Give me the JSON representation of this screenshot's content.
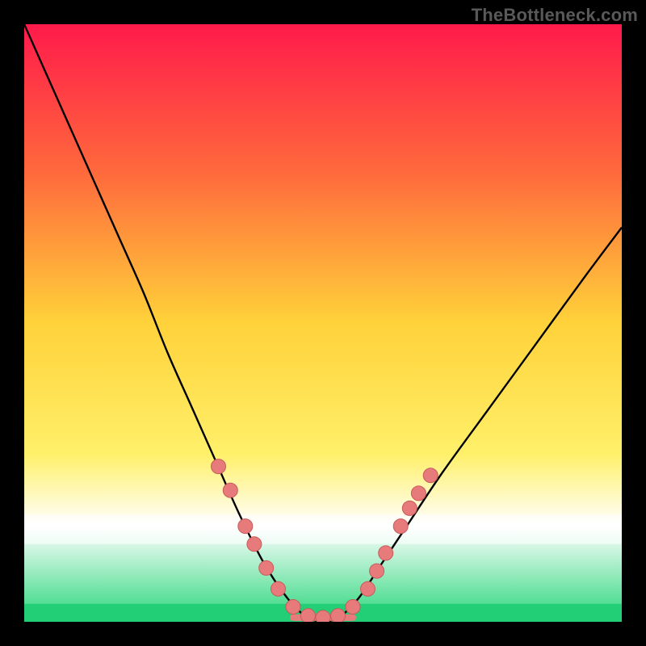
{
  "watermark": "TheBottleneck.com",
  "chart_data": {
    "type": "line",
    "title": "",
    "xlabel": "",
    "ylabel": "",
    "xlim": [
      0,
      100
    ],
    "ylim": [
      0,
      100
    ],
    "grid": false,
    "legend": false,
    "gradient_stops": [
      {
        "offset": 0,
        "color": "#ff1a4b"
      },
      {
        "offset": 25,
        "color": "#ff6a3c"
      },
      {
        "offset": 50,
        "color": "#ffd23a"
      },
      {
        "offset": 72,
        "color": "#fff06a"
      },
      {
        "offset": 84,
        "color": "#ffffff"
      },
      {
        "offset": 100,
        "color": "#2bd67b"
      }
    ],
    "green_band": {
      "y_from": 97,
      "y_to": 100
    },
    "white_band": {
      "y_from": 82,
      "y_to": 87
    },
    "series": [
      {
        "name": "bottleneck-curve",
        "color": "#000000",
        "x": [
          0,
          4,
          8,
          12,
          16,
          20,
          24,
          28,
          32,
          36,
          40,
          44,
          47,
          50,
          53,
          56,
          60,
          64,
          70,
          78,
          86,
          94,
          100
        ],
        "y": [
          0,
          9,
          18,
          27,
          36,
          45,
          55,
          64,
          73,
          82,
          90,
          96,
          99,
          100,
          99,
          96,
          90,
          84,
          75,
          64,
          53,
          42,
          34
        ]
      }
    ],
    "markers": {
      "color": "#e77b7b",
      "stroke": "#c85a5a",
      "radius": 9,
      "points": [
        {
          "x": 32.5,
          "y": 74
        },
        {
          "x": 34.5,
          "y": 78
        },
        {
          "x": 37.0,
          "y": 84
        },
        {
          "x": 38.5,
          "y": 87
        },
        {
          "x": 40.5,
          "y": 91
        },
        {
          "x": 42.5,
          "y": 94.5
        },
        {
          "x": 45.0,
          "y": 97.5
        },
        {
          "x": 47.5,
          "y": 99.0
        },
        {
          "x": 50.0,
          "y": 99.3
        },
        {
          "x": 52.5,
          "y": 99.0
        },
        {
          "x": 55.0,
          "y": 97.5
        },
        {
          "x": 57.5,
          "y": 94.5
        },
        {
          "x": 59.0,
          "y": 91.5
        },
        {
          "x": 60.5,
          "y": 88.5
        },
        {
          "x": 63.0,
          "y": 84.0
        },
        {
          "x": 64.5,
          "y": 81.0
        },
        {
          "x": 66.0,
          "y": 78.5
        },
        {
          "x": 68.0,
          "y": 75.5
        }
      ]
    },
    "flat_segment": {
      "color": "#e77b7b",
      "y": 99.3,
      "x_from": 45,
      "x_to": 55,
      "thickness": 8
    }
  }
}
